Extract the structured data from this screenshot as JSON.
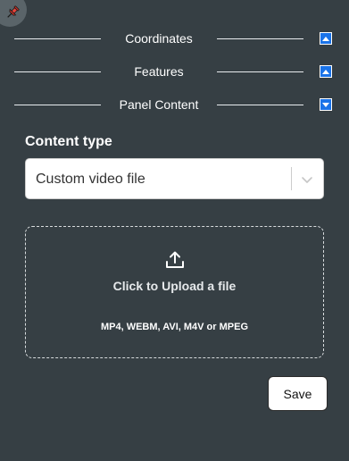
{
  "pin": {
    "icon": "pushpin-icon"
  },
  "sections": [
    {
      "label": "Coordinates",
      "toggle_icon": "caret-up-icon"
    },
    {
      "label": "Features",
      "toggle_icon": "caret-up-icon"
    },
    {
      "label": "Panel Content",
      "toggle_icon": "caret-down-icon"
    }
  ],
  "content_type": {
    "label": "Content type",
    "selected": "Custom video file",
    "dropdown_icon": "chevron-down-icon"
  },
  "upload": {
    "icon": "upload-icon",
    "title": "Click to Upload a file",
    "formats": "MP4, WEBM, AVI, M4V or MPEG"
  },
  "actions": {
    "save_label": "Save"
  },
  "colors": {
    "background": "#363f44",
    "toggle_blue": "#1a73e8",
    "pin_red": "#d93025"
  }
}
